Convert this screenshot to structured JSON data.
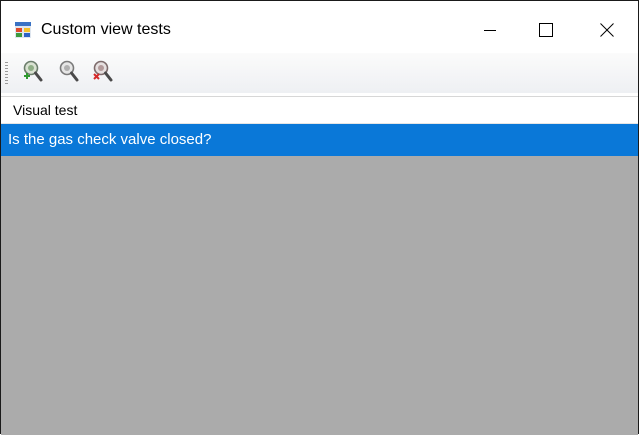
{
  "window": {
    "title": "Custom view tests",
    "icon": "app-window-icon"
  },
  "titlebar_buttons": [
    {
      "name": "minimize",
      "glyph": "minimize-icon"
    },
    {
      "name": "maximize",
      "glyph": "maximize-icon"
    },
    {
      "name": "close",
      "glyph": "close-icon"
    }
  ],
  "toolbar": {
    "tools": [
      {
        "name": "add-test",
        "icon": "zoom-add-icon"
      },
      {
        "name": "edit-test",
        "icon": "zoom-edit-icon"
      },
      {
        "name": "remove-test",
        "icon": "zoom-remove-icon"
      }
    ]
  },
  "list": {
    "header": "Visual test",
    "rows": [
      {
        "label": "Is the gas check valve closed?",
        "selected": true
      }
    ]
  },
  "colors": {
    "selection": "#0a78d8",
    "background": "#ababab"
  }
}
